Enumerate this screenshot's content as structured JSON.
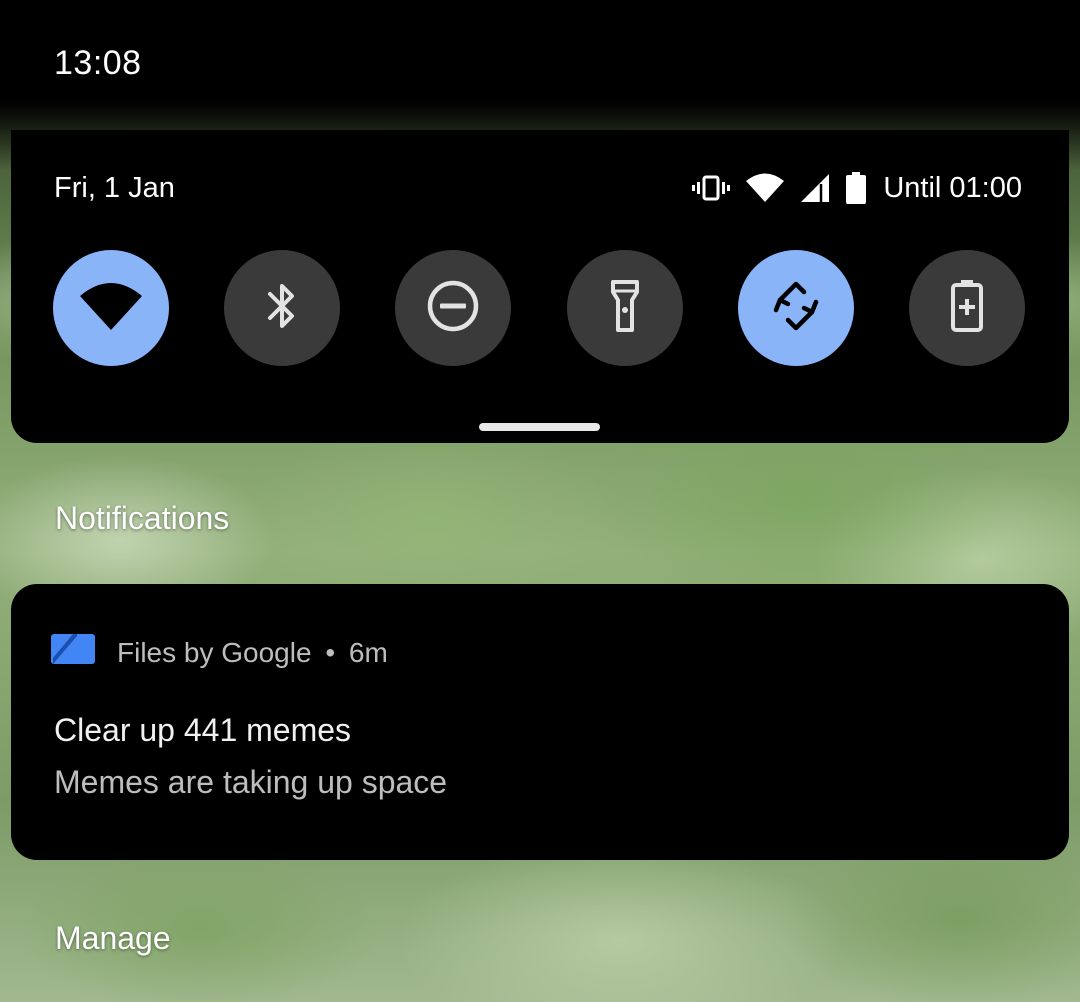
{
  "status_bar": {
    "time": "13:08"
  },
  "quick_settings": {
    "date": "Fri, 1 Jan",
    "battery_status": "Until 01:00",
    "status_icons": [
      "vibrate-icon",
      "wifi-icon",
      "cellular-signal-icon",
      "battery-icon"
    ],
    "tiles": [
      {
        "name": "Wi-Fi",
        "icon": "wifi-icon",
        "active": true
      },
      {
        "name": "Bluetooth",
        "icon": "bluetooth-icon",
        "active": false
      },
      {
        "name": "Do Not Disturb",
        "icon": "do-not-disturb-icon",
        "active": false
      },
      {
        "name": "Torch",
        "icon": "flashlight-icon",
        "active": false
      },
      {
        "name": "Auto-rotate",
        "icon": "auto-rotate-icon",
        "active": true
      },
      {
        "name": "Battery Saver",
        "icon": "battery-saver-icon",
        "active": false
      }
    ],
    "colors": {
      "tile_active": "#8ab4f8",
      "tile_inactive": "#3a3a3a",
      "icon_active": "#000000",
      "icon_inactive": "#e3e3e3"
    }
  },
  "notifications": {
    "section_title": "Notifications",
    "items": [
      {
        "app_name": "Files by Google",
        "separator": "•",
        "time_ago": "6m",
        "title": "Clear up 441 memes",
        "body": "Memes are taking up space",
        "app_icon": "files-by-google-icon",
        "app_icon_color": "#4285f4"
      }
    ],
    "manage_label": "Manage"
  }
}
